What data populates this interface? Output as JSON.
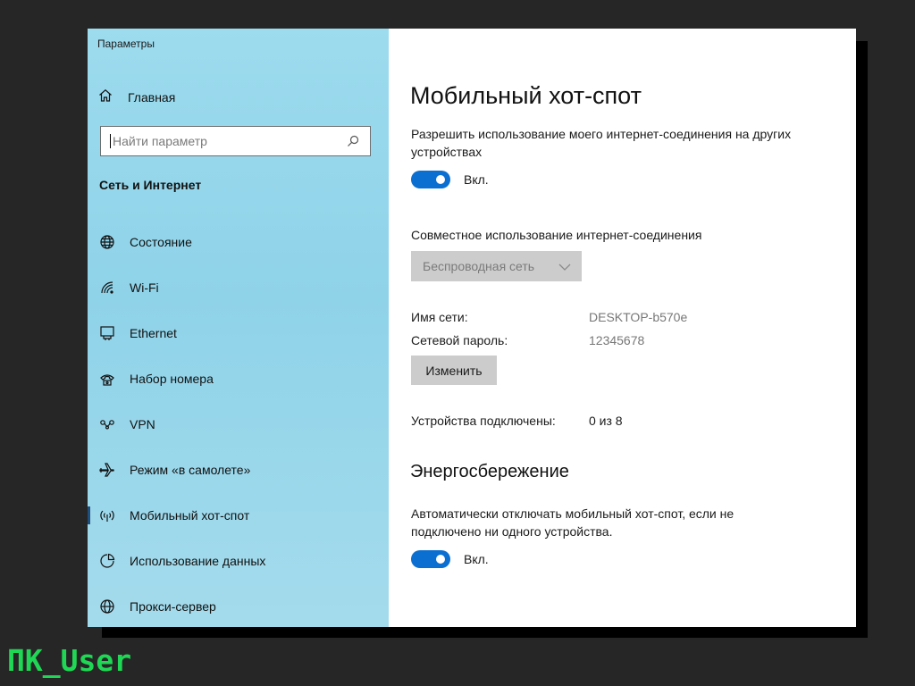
{
  "window": {
    "title": "Параметры"
  },
  "sidebar": {
    "home_label": "Главная",
    "search_placeholder": "Найти параметр",
    "section_title": "Сеть и Интернет",
    "items": [
      {
        "label": "Состояние",
        "icon": "globe-icon"
      },
      {
        "label": "Wi-Fi",
        "icon": "wifi-icon"
      },
      {
        "label": "Ethernet",
        "icon": "ethernet-icon"
      },
      {
        "label": "Набор номера",
        "icon": "dialup-icon"
      },
      {
        "label": "VPN",
        "icon": "vpn-icon"
      },
      {
        "label": "Режим «в самолете»",
        "icon": "airplane-icon"
      },
      {
        "label": "Мобильный хот-спот",
        "icon": "hotspot-icon",
        "active": true
      },
      {
        "label": "Использование данных",
        "icon": "data-usage-icon"
      },
      {
        "label": "Прокси-сервер",
        "icon": "globe-icon"
      }
    ]
  },
  "main": {
    "title": "Мобильный хот-спот",
    "share_desc": "Разрешить использование моего интернет-соединения на других устройствах",
    "share_toggle": {
      "state": "Вкл.",
      "on": true
    },
    "share_from_label": "Совместное использование интернет-соединения",
    "share_from_value": "Беспроводная сеть",
    "network_name_label": "Имя сети:",
    "network_name_value": "DESKTOP-b570e",
    "password_label": "Сетевой пароль:",
    "password_value": "12345678",
    "edit_button": "Изменить",
    "devices_label": "Устройства подключены:",
    "devices_value": "0 из 8",
    "power_title": "Энергосбережение",
    "power_desc": "Автоматически отключать мобильный хот-спот, если не подключено ни одного устройства.",
    "power_toggle": {
      "state": "Вкл.",
      "on": true
    }
  },
  "watermark": "ПК_User",
  "colors": {
    "accent": "#0a6fd1",
    "sidebar": "#9ddbee",
    "watermark": "#1fd655",
    "backdrop": "#262626"
  }
}
